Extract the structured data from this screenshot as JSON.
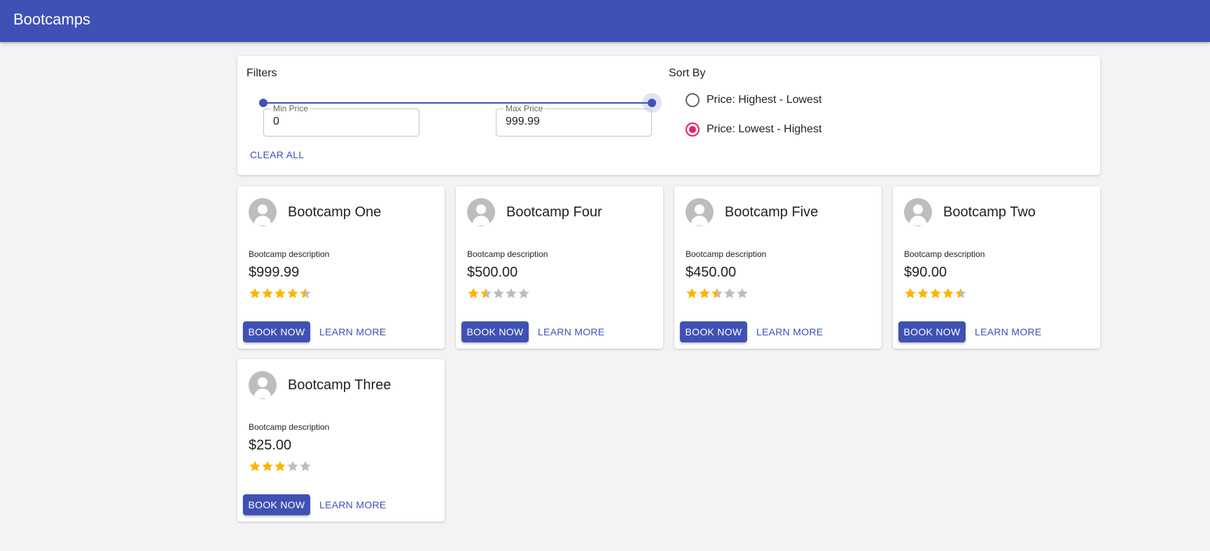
{
  "appbar": {
    "title": "Bootcamps"
  },
  "filters": {
    "label": "Filters",
    "slider": {
      "min": 0,
      "max": 999.99,
      "low": 0,
      "high": 999.99
    },
    "min_price": {
      "label": "Min Price",
      "value": "0"
    },
    "max_price": {
      "label": "Max Price",
      "value": "999.99"
    },
    "clear_label": "CLEAR ALL"
  },
  "sort": {
    "label": "Sort By",
    "options": [
      {
        "label": "Price: Highest - Lowest",
        "checked": false
      },
      {
        "label": "Price: Lowest - Highest",
        "checked": true
      }
    ]
  },
  "colors": {
    "primary": "#3f51b5",
    "accent": "#e91e63",
    "star": "#ffb400",
    "star_empty": "#bdbdbd"
  },
  "cards": [
    {
      "name": "Bootcamp One",
      "description": "Bootcamp description",
      "price": "$999.99",
      "rating": 4.5,
      "book_label": "BOOK NOW",
      "learn_label": "LEARN MORE"
    },
    {
      "name": "Bootcamp Four",
      "description": "Bootcamp description",
      "price": "$500.00",
      "rating": 1.5,
      "book_label": "BOOK NOW",
      "learn_label": "LEARN MORE"
    },
    {
      "name": "Bootcamp Five",
      "description": "Bootcamp description",
      "price": "$450.00",
      "rating": 2.5,
      "book_label": "BOOK NOW",
      "learn_label": "LEARN MORE"
    },
    {
      "name": "Bootcamp Two",
      "description": "Bootcamp description",
      "price": "$90.00",
      "rating": 4.5,
      "book_label": "BOOK NOW",
      "learn_label": "LEARN MORE"
    },
    {
      "name": "Bootcamp Three",
      "description": "Bootcamp description",
      "price": "$25.00",
      "rating": 3,
      "book_label": "BOOK NOW",
      "learn_label": "LEARN MORE"
    }
  ]
}
